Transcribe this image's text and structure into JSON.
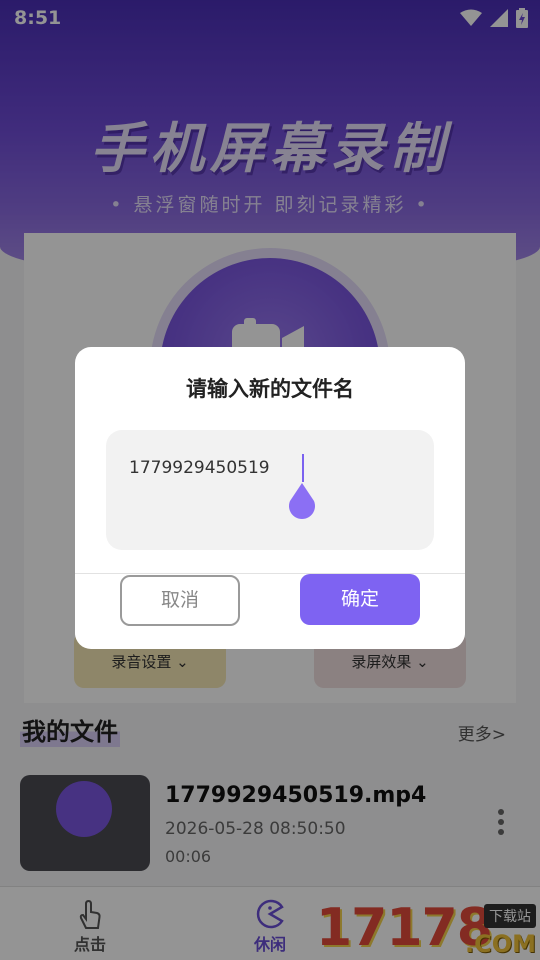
{
  "status_bar": {
    "time": "8:51"
  },
  "hero": {
    "title": "手机屏幕录制",
    "subtitle": "• 悬浮窗随时开  即刻记录精彩 •"
  },
  "settings": {
    "audio_label": "录音设置 ⌄",
    "effect_label": "录屏效果 ⌄"
  },
  "files": {
    "heading": "我的文件",
    "more": "更多>",
    "items": [
      {
        "name": "1779929450519.mp4",
        "date": "2026-05-28 08:50:50",
        "duration": "00:06"
      }
    ]
  },
  "tabs": [
    {
      "label": "点击",
      "icon": "hand-tap-icon"
    },
    {
      "label": "休闲",
      "icon": "pacman-icon"
    }
  ],
  "watermark": {
    "number": "17178",
    "badge": "下载站",
    "suffix": ".COM"
  },
  "dialog": {
    "title": "请输入新的文件名",
    "input_value": "1779929450519",
    "cancel_label": "取消",
    "ok_label": "确定"
  },
  "colors": {
    "accent": "#7e63f2",
    "hero": "#6e4bd6"
  }
}
